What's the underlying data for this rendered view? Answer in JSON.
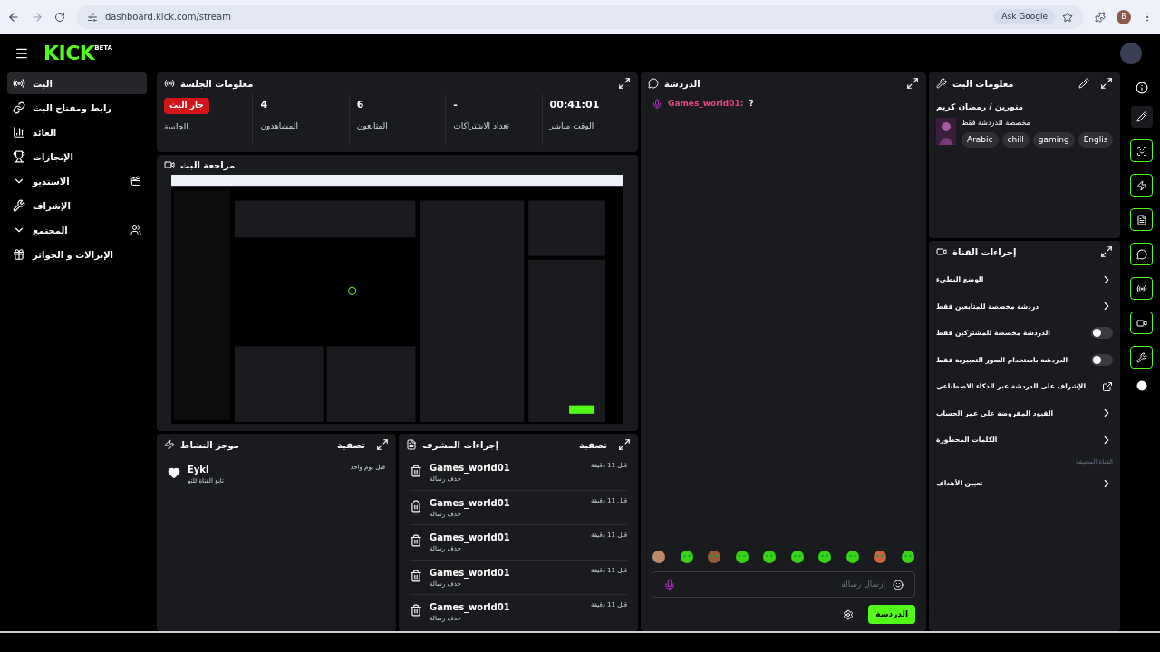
{
  "browser": {
    "url": "dashboard.kick.com/stream",
    "ask_google": "Ask Google",
    "profile": "B"
  },
  "logo": {
    "text": "KICK",
    "badge": "BETA"
  },
  "sidebar": {
    "items": [
      {
        "label": "البث",
        "selected": true,
        "expandable": false
      },
      {
        "label": "رابط ومفتاح البث",
        "selected": false,
        "expandable": false
      },
      {
        "label": "العائد",
        "selected": false,
        "expandable": false
      },
      {
        "label": "الإنجازات",
        "selected": false,
        "expandable": false
      },
      {
        "label": "الاستديو",
        "selected": false,
        "expandable": true
      },
      {
        "label": "الإشراف",
        "selected": false,
        "expandable": false
      },
      {
        "label": "المجتمع",
        "selected": false,
        "expandable": true
      },
      {
        "label": "الإنزالات و الجوائز",
        "selected": false,
        "expandable": false
      }
    ]
  },
  "session": {
    "title": "معلومات الجلسة",
    "stats": [
      {
        "kind": "number",
        "value": "00:41:01",
        "label": "الوقت مباشر"
      },
      {
        "kind": "number",
        "value": "-",
        "label": "تعداد الاشتراكات"
      },
      {
        "kind": "number",
        "value": "6",
        "label": "المتابعون"
      },
      {
        "kind": "number",
        "value": "4",
        "label": "المشاهدون"
      },
      {
        "kind": "badge",
        "value": "جار البث",
        "label": "الجلسة"
      }
    ]
  },
  "preview": {
    "title": "مراجعة البث",
    "kind": "picture"
  },
  "activity": {
    "title": "موجز النشاط",
    "filter": "تصفية",
    "items": [
      {
        "user": "Eykl",
        "action": "تابع القناة للتو",
        "time": "قبل يوم واحد"
      }
    ]
  },
  "mod_actions": {
    "title": "إجراءات المشرف",
    "filter": "تصفية",
    "items": [
      {
        "user": "Games_world01",
        "action": "حذف رسالة",
        "time": "قبل 11 دقيقة"
      },
      {
        "user": "Games_world01",
        "action": "حذف رسالة",
        "time": "قبل 11 دقيقة"
      },
      {
        "user": "Games_world01",
        "action": "حذف رسالة",
        "time": "قبل 11 دقيقة"
      },
      {
        "user": "Games_world01",
        "action": "حذف رسالة",
        "time": "قبل 11 دقيقة"
      },
      {
        "user": "Games_world01",
        "action": "حذف رسالة",
        "time": "قبل 11 دقيقة"
      }
    ]
  },
  "chat": {
    "title": "الدردشة",
    "messages": [
      {
        "user": "Games_world01:",
        "text": "?",
        "color": "#e2487f"
      }
    ],
    "placeholder": "إرسال رسالة",
    "send": "الدردشة"
  },
  "stream_info": {
    "title": "معلومات البث",
    "stream_title": "متورين / رمضان كريم",
    "category": "مخصصة للدردشة فقط",
    "tags": [
      "Englis",
      "gaming",
      "chill",
      "Arabic"
    ]
  },
  "channel_actions": {
    "title": "إجراءات القناة",
    "items": [
      {
        "kind": "chevron",
        "label": "الوضع البطيء"
      },
      {
        "kind": "chevron",
        "label": "دردشة مخصصة للمتابعين فقط"
      },
      {
        "kind": "toggle",
        "label": "الدردشة مخصصة للمشتركين فقط",
        "on": false
      },
      {
        "kind": "toggle",
        "label": "الدردشة باستخدام الصور التعبيرية فقط",
        "on": false
      },
      {
        "kind": "external",
        "label": "الإشراف على الدردشة عبر الذكاء الاصطناعي"
      },
      {
        "kind": "chevron",
        "label": "القيود المفروضة على عمر الحساب"
      },
      {
        "kind": "chevron",
        "label": "الكلمات المحظورة"
      },
      {
        "kind": "section",
        "label": "القناة المضيفة"
      },
      {
        "kind": "chevron",
        "label": "تعيين الأهداف"
      }
    ]
  }
}
